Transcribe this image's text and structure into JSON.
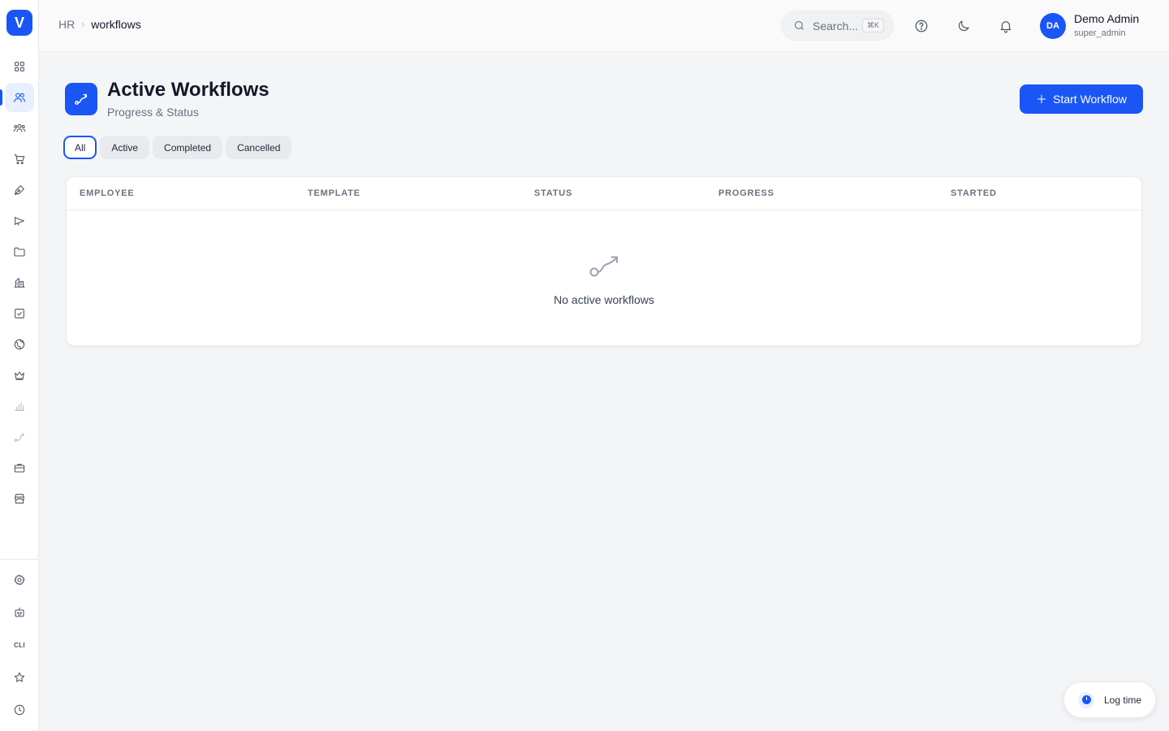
{
  "brand": {
    "logo_letter": "V"
  },
  "sidebar": {
    "items": [
      {
        "name": "dashboard",
        "icon": "grid-icon"
      },
      {
        "name": "hr",
        "icon": "users-icon",
        "active": true
      },
      {
        "name": "teams",
        "icon": "team-icon"
      },
      {
        "name": "commerce",
        "icon": "cart-icon"
      },
      {
        "name": "content",
        "icon": "pen-icon"
      },
      {
        "name": "marketing",
        "icon": "megaphone-icon"
      },
      {
        "name": "files",
        "icon": "folder-icon"
      },
      {
        "name": "organization",
        "icon": "building-icon"
      },
      {
        "name": "tasks",
        "icon": "checkbox-icon"
      },
      {
        "name": "sites",
        "icon": "globe-icon"
      },
      {
        "name": "membership",
        "icon": "crown-icon"
      },
      {
        "name": "analytics",
        "icon": "bar-chart-icon"
      },
      {
        "name": "workflows",
        "icon": "route-icon"
      },
      {
        "name": "jobs",
        "icon": "briefcase-icon"
      },
      {
        "name": "store",
        "icon": "store-icon"
      }
    ],
    "bottom": [
      {
        "name": "settings",
        "icon": "gear-icon"
      },
      {
        "name": "ai-assistant",
        "icon": "robot-icon"
      },
      {
        "name": "cli",
        "label": "CLI"
      },
      {
        "name": "favorites",
        "icon": "star-icon"
      },
      {
        "name": "history",
        "icon": "clock-icon"
      }
    ]
  },
  "topbar": {
    "breadcrumb": {
      "root": "HR",
      "current": "workflows"
    },
    "search": {
      "placeholder": "Search...",
      "shortcut": "⌘K"
    },
    "user": {
      "initials": "DA",
      "name": "Demo Admin",
      "role": "super_admin"
    }
  },
  "page": {
    "title": "Active Workflows",
    "subtitle": "Progress & Status",
    "primary_action": "Start Workflow"
  },
  "filters": [
    "All",
    "Active",
    "Completed",
    "Cancelled"
  ],
  "selected_filter": "All",
  "table": {
    "columns": [
      "EMPLOYEE",
      "TEMPLATE",
      "STATUS",
      "PROGRESS",
      "STARTED"
    ],
    "rows": [],
    "empty_message": "No active workflows"
  },
  "log_time": {
    "label": "Log time"
  },
  "colors": {
    "accent": "#1a56f5",
    "background": "#f4f5f7",
    "surface": "#ffffff"
  }
}
